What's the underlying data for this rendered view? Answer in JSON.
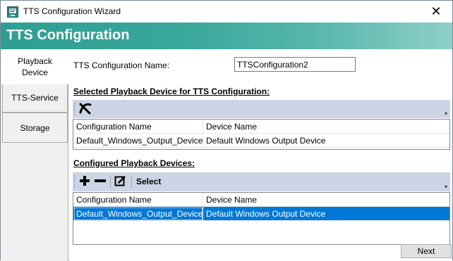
{
  "window": {
    "title": "TTS Configuration Wizard",
    "close_glyph": "✕"
  },
  "header": {
    "title": "TTS Configuration"
  },
  "nav": {
    "tabs": [
      {
        "label_line1": "Playback",
        "label_line2": "Device",
        "active": true
      },
      {
        "label": "TTS-Service",
        "active": false
      },
      {
        "label": "Storage",
        "active": false
      }
    ]
  },
  "form": {
    "config_name_label": "TTS Configuration Name:",
    "config_name_value": "TTSConfiguration2"
  },
  "selected_section": {
    "title": "Selected Playback Device for TTS Configuration:",
    "toolbar": {
      "remove_icon": "x-remove-icon"
    },
    "columns": [
      "Configuration Name",
      "Device Name"
    ],
    "rows": [
      {
        "config": "Default_Windows_Output_Device",
        "device": "Default Windows Output Device"
      }
    ]
  },
  "configured_section": {
    "title": "Configured Playback Devices:",
    "toolbar": {
      "add_icon": "plus-icon",
      "remove_icon": "minus-icon",
      "edit_icon": "edit-icon",
      "select_label": "Select"
    },
    "columns": [
      "Configuration Name",
      "Device Name"
    ],
    "rows": [
      {
        "config": "Default_Windows_Output_Device",
        "device": "Default Windows Output Device",
        "selected": true
      }
    ]
  },
  "footer": {
    "next_label": "Next"
  },
  "colors": {
    "banner": "#2e9e92",
    "toolbar": "#ccd5e5",
    "selection": "#0078d7"
  }
}
